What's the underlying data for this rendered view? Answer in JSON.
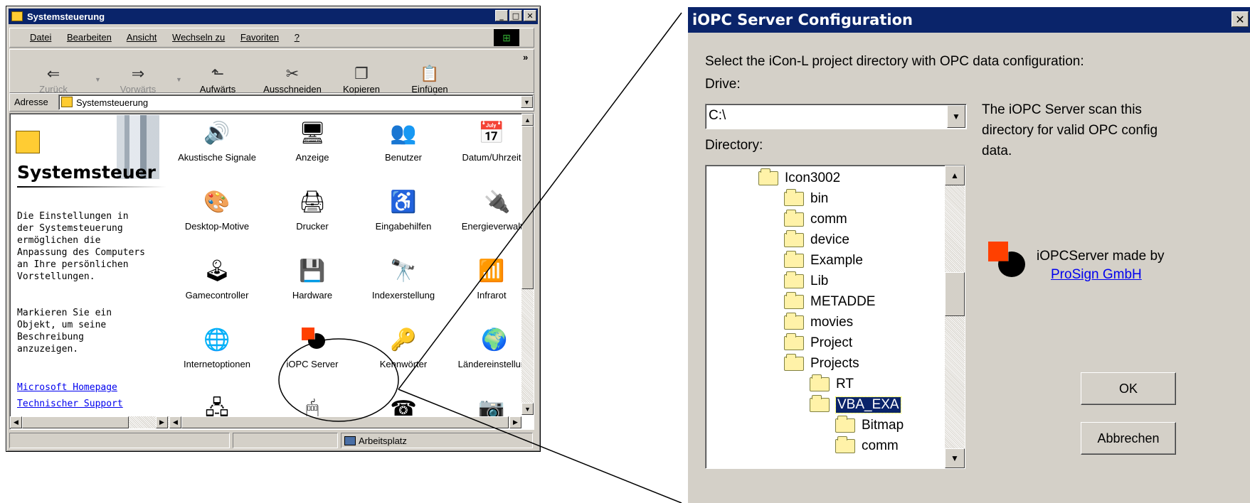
{
  "explorer": {
    "title": "Systemsteuerung",
    "menu": [
      "Datei",
      "Bearbeiten",
      "Ansicht",
      "Wechseln zu",
      "Favoriten",
      "?"
    ],
    "toolbar": {
      "back": "Zurück",
      "forward": "Vorwärts",
      "up": "Aufwärts",
      "cut": "Ausschneiden",
      "copy": "Kopieren",
      "paste": "Einfügen",
      "more": "»"
    },
    "address_label": "Adresse",
    "address_value": "Systemsteuerung",
    "panel_title": "Systemsteuer",
    "panel_text_1": "Die Einstellungen in der Systemsteuerung ermöglichen die Anpassung des Computers an Ihre persönlichen Vorstellungen.",
    "panel_text_2": "Markieren Sie ein Objekt, um seine Beschreibung anzuzeigen.",
    "links": [
      "Microsoft Homepage",
      "Technischer Support"
    ],
    "items": [
      "Akustische Signale",
      "Anzeige",
      "Benutzer",
      "Datum/Uhrzeit",
      "Desktop-Motive",
      "Drucker",
      "Eingabehilfen",
      "Energieverwaltun",
      "Gamecontroller",
      "Hardware",
      "Indexerstellung",
      "Infrarot",
      "Internetoptionen",
      "iOPC Server",
      "Kennwörter",
      "Ländereinstellung"
    ],
    "status": "Arbeitsplatz"
  },
  "dialog": {
    "title": "iOPC Server Configuration",
    "instruction": "Select the iCon-L project directory with OPC data configuration:",
    "drive_label": "Drive:",
    "drive_value": "C:\\",
    "directory_label": "Directory:",
    "info": "The iOPC Server scan this directory for valid OPC config data.",
    "made_by": "iOPCServer made by",
    "made_by_link": "ProSign GmbH",
    "dirs": [
      "Icon3002",
      "bin",
      "comm",
      "device",
      "Example",
      "Lib",
      "METADDE",
      "movies",
      "Project",
      "Projects",
      "RT",
      "VBA_EXA",
      "Bitmap",
      "comm"
    ],
    "ok": "OK",
    "cancel": "Abbrechen"
  },
  "colors": {
    "titlebar": "#0a246a",
    "face": "#d4d0c8",
    "selection": "#0a246a",
    "logo_orange": "#ff4000"
  }
}
